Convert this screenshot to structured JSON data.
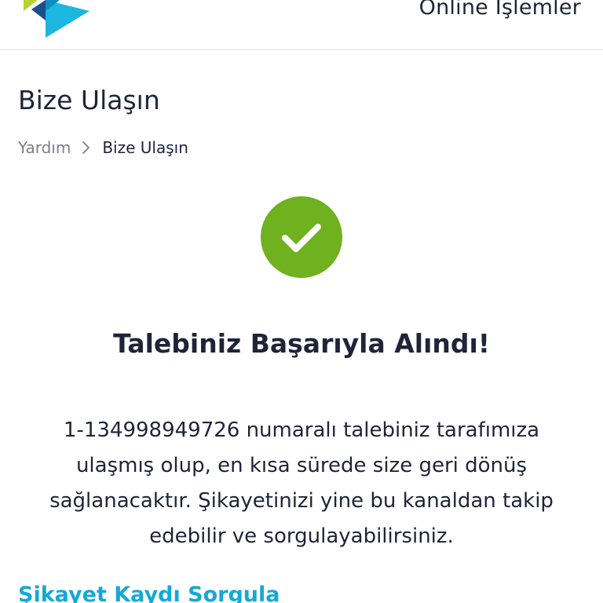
{
  "header": {
    "logo_icon": "brand-logo-icon",
    "online_label": "Online İşlemler"
  },
  "page": {
    "title": "Bize Ulaşın"
  },
  "breadcrumb": {
    "home_label": "Yardım",
    "separator_icon": "chevron-right-icon",
    "current_label": "Bize Ulaşın"
  },
  "result": {
    "icon": "checkmark-circle-icon",
    "title": "Talebiniz Başarıyla Alındı!",
    "message": "1-134998949726 numaralı talebiniz tarafımıza ulaşmış olup, en kısa sürede size geri dönüş sağlanacaktır. Şikayetinizi yine bu kanaldan takip edebilir ve sorgulayabilirsiniz."
  },
  "links": {
    "complaint_query": "Şikayet Kaydı Sorgula"
  },
  "colors": {
    "success_green": "#6fb11f",
    "link_blue": "#14a9d6",
    "text_dark": "#1f2438",
    "text_muted": "#7b7f8c"
  }
}
